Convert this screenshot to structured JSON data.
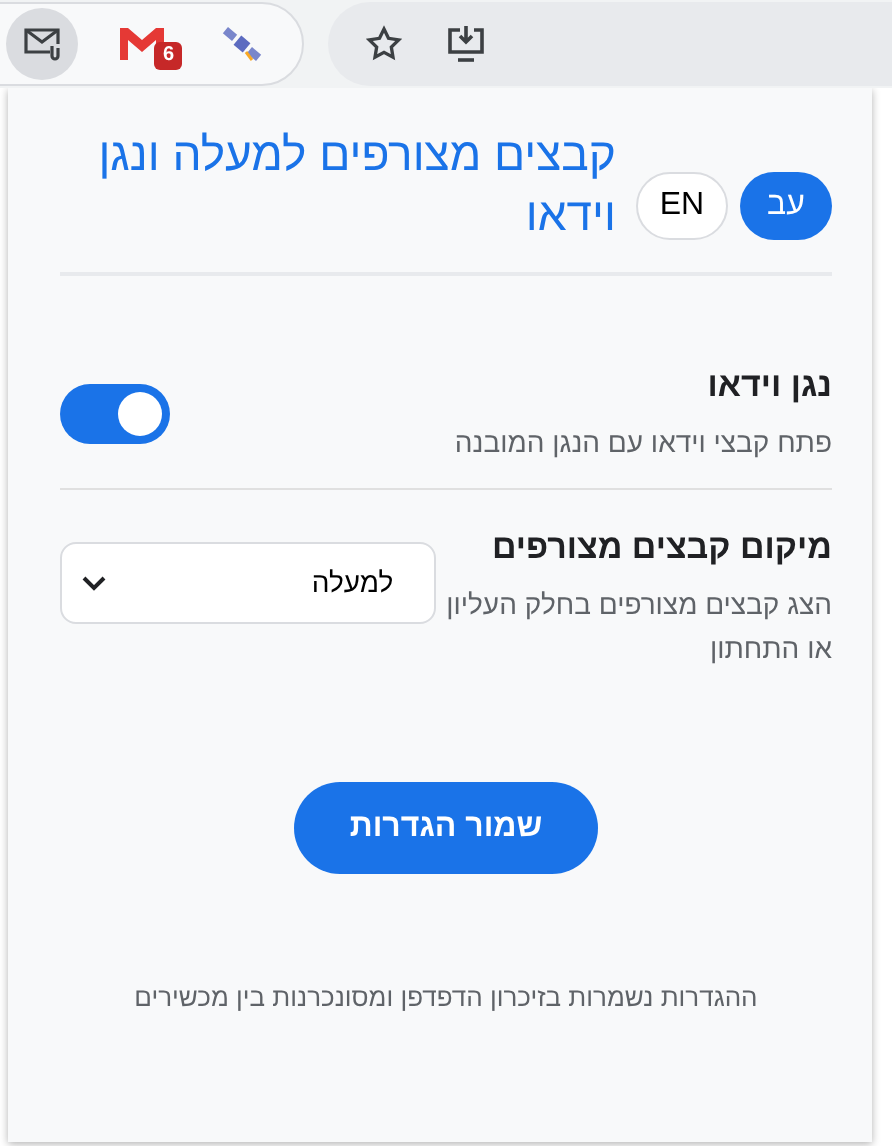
{
  "toolbar": {
    "extensions": [
      {
        "kind": "mail",
        "selected": true
      },
      {
        "kind": "gmail",
        "selected": false,
        "badge": "6"
      },
      {
        "kind": "satellite",
        "selected": false
      }
    ]
  },
  "popup": {
    "title": "קבצים מצורפים למעלה ונגן וידאו",
    "languages": [
      {
        "label": "עב",
        "selected": true
      },
      {
        "label": "EN",
        "selected": false
      }
    ],
    "settings": [
      {
        "kind": "toggle",
        "title": "נגן וידאו",
        "description": "פתח קבצי וידאו עם הנגן המובנה",
        "on": true
      },
      {
        "kind": "select",
        "title": "מיקום קבצים מצורפים",
        "description": "הצג קבצים מצורפים בחלק העליון או התחתון",
        "value": "למעלה"
      }
    ],
    "save_button": "שמור הגדרות",
    "footer": "ההגדרות נשמרות בזיכרון הדפדפן ומסונכרנות בין מכשירים"
  }
}
